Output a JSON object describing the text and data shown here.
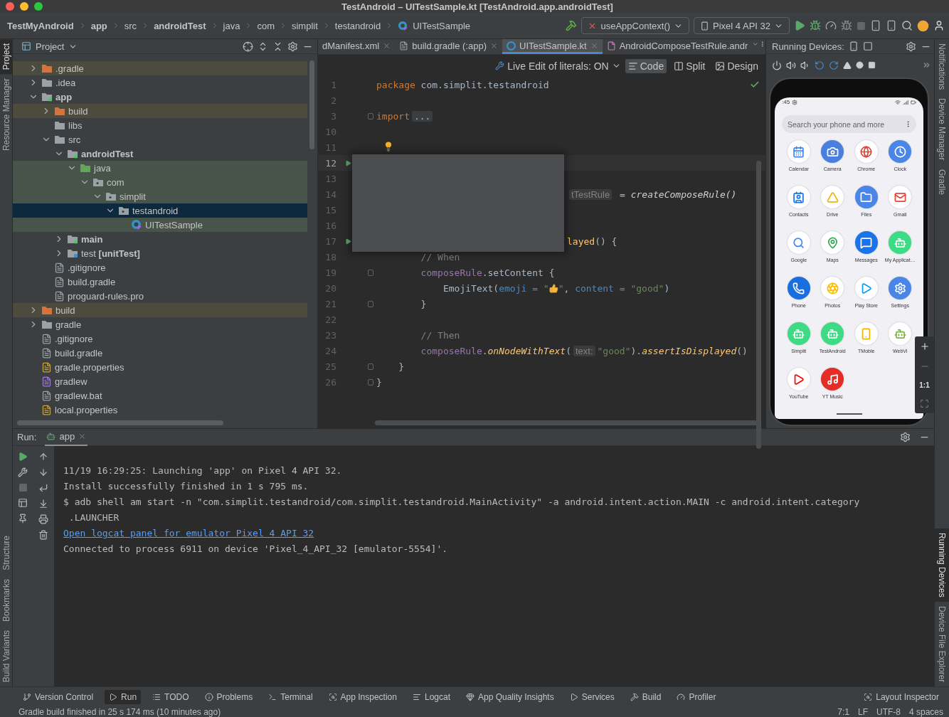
{
  "window": {
    "title": "TestAndroid – UITestSample.kt [TestAndroid.app.androidTest]"
  },
  "breadcrumb": [
    {
      "label": "TestMyAndroid",
      "bold": true
    },
    {
      "label": "app",
      "bold": true
    },
    {
      "label": "src",
      "bold": false
    },
    {
      "label": "androidTest",
      "bold": true
    },
    {
      "label": "java",
      "bold": false
    },
    {
      "label": "com",
      "bold": false
    },
    {
      "label": "simplit",
      "bold": false
    },
    {
      "label": "testandroid",
      "bold": false
    }
  ],
  "current_file": "UITestSample",
  "toolbar": {
    "run_config": "useAppContext()",
    "device": "Pixel 4 API 32"
  },
  "left_tool_tabs": [
    {
      "label": "Project",
      "selected": true
    },
    {
      "label": "Resource Manager",
      "selected": false
    },
    {
      "label": "Structure",
      "selected": false
    },
    {
      "label": "Bookmarks",
      "selected": false
    },
    {
      "label": "Build Variants",
      "selected": false
    }
  ],
  "right_tool_tabs": [
    {
      "label": "Notifications",
      "selected": false
    },
    {
      "label": "Device Manager",
      "selected": false
    },
    {
      "label": "Gradle",
      "selected": false
    },
    {
      "label": "Running Devices",
      "selected": true
    },
    {
      "label": "Device File Explorer",
      "selected": false
    }
  ],
  "project_panel": {
    "title": "Project",
    "tree": [
      {
        "label": ".gradle",
        "kind": "excluded-folder",
        "excluded": true,
        "test_source": false,
        "bold": false,
        "selected": false,
        "expanded": false
      },
      {
        "label": ".idea",
        "kind": "folder",
        "excluded": false,
        "test_source": false,
        "bold": false,
        "selected": false,
        "expanded": false
      },
      {
        "label": "app",
        "kind": "module",
        "excluded": false,
        "test_source": false,
        "bold": true,
        "selected": false,
        "expanded": true,
        "children": [
          {
            "label": "build",
            "kind": "excluded-folder",
            "excluded": true,
            "test_source": false,
            "bold": false,
            "selected": false,
            "expanded": false
          },
          {
            "label": "libs",
            "kind": "folder",
            "excluded": false,
            "test_source": false,
            "bold": false,
            "selected": false
          },
          {
            "label": "src",
            "kind": "folder",
            "excluded": false,
            "test_source": false,
            "bold": false,
            "selected": false,
            "expanded": true,
            "children": [
              {
                "label": "androidTest",
                "kind": "module",
                "excluded": false,
                "test_source": false,
                "bold": true,
                "selected": false,
                "expanded": true,
                "children": [
                  {
                    "label": "java",
                    "kind": "test-folder",
                    "excluded": false,
                    "test_source": true,
                    "bold": false,
                    "selected": false,
                    "expanded": true,
                    "children": [
                      {
                        "label": "com",
                        "kind": "package",
                        "excluded": false,
                        "test_source": true,
                        "bold": false,
                        "selected": false,
                        "expanded": true,
                        "children": [
                          {
                            "label": "simplit",
                            "kind": "package",
                            "excluded": false,
                            "test_source": true,
                            "bold": false,
                            "selected": false,
                            "expanded": true,
                            "children": [
                              {
                                "label": "testandroid",
                                "kind": "package",
                                "excluded": false,
                                "test_source": true,
                                "bold": false,
                                "selected": true,
                                "expanded": true,
                                "children": [
                                  {
                                    "label": "UITestSample",
                                    "kind": "test-class",
                                    "excluded": false,
                                    "test_source": true,
                                    "bold": false,
                                    "selected": false
                                  }
                                ]
                              }
                            ]
                          }
                        ]
                      }
                    ]
                  }
                ]
              },
              {
                "label": "main",
                "kind": "module",
                "excluded": false,
                "test_source": false,
                "bold": true,
                "selected": false,
                "expanded": false
              },
              {
                "label": "test **[unitTest]**",
                "kind": "unit-test-folder",
                "excluded": false,
                "test_source": false,
                "bold": false,
                "selected": false,
                "expanded": false
              }
            ]
          },
          {
            "label": ".gitignore",
            "kind": "ignore-file",
            "excluded": false,
            "test_source": false,
            "bold": false,
            "selected": false
          },
          {
            "label": "build.gradle",
            "kind": "gradle-file",
            "excluded": false,
            "test_source": false,
            "bold": false,
            "selected": false
          },
          {
            "label": "proguard-rules.pro",
            "kind": "text-file",
            "excluded": false,
            "test_source": false,
            "bold": false,
            "selected": false
          }
        ]
      },
      {
        "label": "build",
        "kind": "excluded-folder",
        "excluded": true,
        "test_source": false,
        "bold": false,
        "selected": false,
        "expanded": false
      },
      {
        "label": "gradle",
        "kind": "folder",
        "excluded": false,
        "test_source": false,
        "bold": false,
        "selected": false,
        "expanded": false
      },
      {
        "label": ".gitignore",
        "kind": "ignore-file",
        "excluded": false,
        "test_source": false,
        "bold": false,
        "selected": false
      },
      {
        "label": "build.gradle",
        "kind": "gradle-file",
        "excluded": false,
        "test_source": false,
        "bold": false,
        "selected": false
      },
      {
        "label": "gradle.properties",
        "kind": "properties-file",
        "excluded": false,
        "test_source": false,
        "bold": false,
        "selected": false
      },
      {
        "label": "gradlew",
        "kind": "script-file",
        "excluded": false,
        "test_source": false,
        "bold": false,
        "selected": false
      },
      {
        "label": "gradlew.bat",
        "kind": "text-file",
        "excluded": false,
        "test_source": false,
        "bold": false,
        "selected": false
      },
      {
        "label": "local.properties",
        "kind": "properties-file",
        "excluded": false,
        "test_source": false,
        "bold": false,
        "selected": false
      }
    ]
  },
  "editor": {
    "tabs": [
      {
        "label": "dManifest.xml",
        "kind": "xml",
        "selected": false
      },
      {
        "label": "build.gradle (:app)",
        "kind": "gradle",
        "selected": false
      },
      {
        "label": "UITestSample.kt",
        "kind": "kotlin",
        "selected": true
      },
      {
        "label": "AndroidComposeTestRule.andr",
        "kind": "class",
        "selected": false
      }
    ],
    "live_edit": "Live Edit of literals: ON",
    "view_modes": [
      {
        "label": "Code",
        "kind": "code",
        "selected": true
      },
      {
        "label": "Split",
        "kind": "split",
        "selected": false
      },
      {
        "label": "Design",
        "kind": "design",
        "selected": false
      }
    ],
    "lines": [
      {
        "number": "1",
        "current": false,
        "run_marker": false,
        "bulb": false,
        "fold": false,
        "after_popup": false,
        "segments": [
          {
            "text": "package",
            "kind": "keyword"
          },
          {
            "text": " com.simplit.testandroid",
            "kind": "plain"
          }
        ]
      },
      {
        "number": "2",
        "current": false,
        "run_marker": false,
        "bulb": false,
        "fold": false
      },
      {
        "number": "3",
        "current": false,
        "run_marker": false,
        "bulb": false,
        "fold": true,
        "after_popup": false,
        "segments": [
          {
            "text": "import",
            "kind": "keyword"
          },
          {
            "text": "...",
            "kind": "folded"
          }
        ]
      },
      {
        "number": "10",
        "current": false,
        "run_marker": false,
        "bulb": false,
        "fold": false
      },
      {
        "number": "11",
        "current": false,
        "run_marker": false,
        "bulb": true,
        "fold": false
      },
      {
        "number": "12",
        "current": true,
        "run_marker": true
      },
      {
        "number": "13",
        "current": false,
        "run_marker": false
      },
      {
        "number": "14",
        "current": false,
        "run_marker": false,
        "after_popup": true,
        "segments": [
          {
            "text": "tTestRule",
            "kind": "hint"
          },
          {
            "text": " = ",
            "kind": "plain"
          },
          {
            "text": "createComposeRule()",
            "kind": "call"
          }
        ]
      },
      {
        "number": "15",
        "current": false,
        "run_marker": false
      },
      {
        "number": "16",
        "current": false,
        "run_marker": false
      },
      {
        "number": "17",
        "current": false,
        "run_marker": true,
        "after_popup": true,
        "segments": [
          {
            "text": "layed",
            "kind": "function"
          },
          {
            "text": "() {",
            "kind": "plain"
          }
        ]
      },
      {
        "number": "18",
        "current": false,
        "run_marker": false,
        "bulb": false,
        "fold": false,
        "after_popup": false,
        "segments": [
          {
            "text": "        // When",
            "kind": "comment"
          }
        ]
      },
      {
        "number": "19",
        "current": false,
        "run_marker": false,
        "bulb": false,
        "fold": true,
        "after_popup": false,
        "segments": [
          {
            "text": "        composeRule",
            "kind": "property"
          },
          {
            "text": ".setContent {",
            "kind": "plain"
          }
        ]
      },
      {
        "number": "20",
        "current": false,
        "run_marker": false,
        "bulb": false,
        "fold": false,
        "after_popup": false,
        "segments": [
          {
            "text": "            EmojiText(",
            "kind": "plain"
          },
          {
            "text": "emoji",
            "kind": "param"
          },
          {
            "text": " = ",
            "kind": "param"
          },
          {
            "text": "\"",
            "kind": "string"
          },
          {
            "kind": "emoji"
          },
          {
            "text": "\"",
            "kind": "string"
          },
          {
            "text": ", ",
            "kind": "plain"
          },
          {
            "text": "content",
            "kind": "param"
          },
          {
            "text": " = ",
            "kind": "param"
          },
          {
            "text": "\"good\"",
            "kind": "string"
          },
          {
            "text": ")",
            "kind": "plain"
          }
        ]
      },
      {
        "number": "21",
        "current": false,
        "run_marker": false,
        "bulb": false,
        "fold": true,
        "after_popup": false,
        "segments": [
          {
            "text": "        }",
            "kind": "plain"
          }
        ]
      },
      {
        "number": "22",
        "current": false,
        "run_marker": false,
        "bulb": false,
        "fold": false
      },
      {
        "number": "23",
        "current": false,
        "run_marker": false,
        "bulb": false,
        "fold": false,
        "after_popup": false,
        "segments": [
          {
            "text": "        // Then",
            "kind": "comment"
          }
        ]
      },
      {
        "number": "24",
        "current": false,
        "run_marker": false,
        "bulb": false,
        "fold": false,
        "after_popup": false,
        "segments": [
          {
            "text": "        composeRule",
            "kind": "property"
          },
          {
            "text": ".",
            "kind": "plain"
          },
          {
            "text": "onNodeWithText",
            "kind": "ext"
          },
          {
            "text": "(",
            "kind": "plain"
          },
          {
            "text": "text:",
            "kind": "hint"
          },
          {
            "text": "\"good\"",
            "kind": "string"
          },
          {
            "text": ").",
            "kind": "plain"
          },
          {
            "text": "assertIsDisplayed",
            "kind": "ext"
          },
          {
            "text": "()",
            "kind": "plain"
          }
        ]
      },
      {
        "number": "25",
        "current": false,
        "run_marker": false,
        "bulb": false,
        "fold": true,
        "after_popup": false,
        "segments": [
          {
            "text": "    }",
            "kind": "plain"
          }
        ]
      },
      {
        "number": "26",
        "current": false,
        "run_marker": false,
        "bulb": false,
        "fold": true,
        "after_popup": false,
        "segments": [
          {
            "text": "}",
            "kind": "plain"
          }
        ]
      }
    ]
  },
  "running_devices": {
    "title": "Running Devices:",
    "phone": {
      "status_time": ":45",
      "search_placeholder": "Search your phone and more",
      "zoom_label": "1:1",
      "apps": [
        {
          "label": "Calendar",
          "color": "#4285f4"
        },
        {
          "label": "Camera",
          "color": "#4a7fe0"
        },
        {
          "label": "Chrome",
          "color": "#db4437"
        },
        {
          "label": "Clock",
          "color": "#4a86e8"
        },
        {
          "label": "Contacts",
          "color": "#1a73e8"
        },
        {
          "label": "Drive",
          "color": "#f4b400"
        },
        {
          "label": "Files",
          "color": "#4a86e8"
        },
        {
          "label": "Gmail",
          "color": "#ea4335"
        },
        {
          "label": "Google",
          "color": "#4285f4"
        },
        {
          "label": "Maps",
          "color": "#34a853"
        },
        {
          "label": "Messages",
          "color": "#1a73e8"
        },
        {
          "label": "My Applicat…",
          "color": "#3ddc84"
        },
        {
          "label": "Phone",
          "color": "#1a6fe0"
        },
        {
          "label": "Photos",
          "color": "#fbbc04"
        },
        {
          "label": "Play Store",
          "color": "#00a0f0"
        },
        {
          "label": "Settings",
          "color": "#4a86e8"
        },
        {
          "label": "Simplit",
          "color": "#3ddc84"
        },
        {
          "label": "TestAndroid",
          "color": "#3ddc84"
        },
        {
          "label": "TMoble",
          "color": "#f0b400"
        },
        {
          "label": "WebVi",
          "color": "#7cb342"
        },
        {
          "label": "YouTube",
          "color": "#ff0000"
        },
        {
          "label": "YT Music",
          "color": "#e52d27"
        }
      ]
    }
  },
  "run_panel": {
    "title": "Run:",
    "tabs": [
      {
        "label": "app",
        "selected": true
      }
    ],
    "console": [
      {
        "text": "11/19 16:29:25: Launching 'app' on Pixel 4 API 32.",
        "kind": "plain"
      },
      {
        "text": "Install successfully finished in 1 s 795 ms.",
        "kind": "plain"
      },
      {
        "text": "$ adb shell am start -n \"com.simplit.testandroid/com.simplit.testandroid.MainActivity\" -a android.intent.action.MAIN -c android.intent.category",
        "kind": "plain"
      },
      {
        "text": " .LAUNCHER",
        "kind": "plain"
      },
      {
        "text": "Open logcat panel for emulator Pixel 4 API 32",
        "kind": "link"
      },
      {
        "text": "Connected to process 6911 on device 'Pixel_4_API_32 [emulator-5554]'.",
        "kind": "plain"
      }
    ]
  },
  "tool_window_bar": [
    {
      "label": "Version Control",
      "selected": false
    },
    {
      "label": "Run",
      "selected": true
    },
    {
      "label": "TODO",
      "selected": false
    },
    {
      "label": "Problems",
      "selected": false
    },
    {
      "label": "Terminal",
      "selected": false
    },
    {
      "label": "App Inspection",
      "selected": false
    },
    {
      "label": "Logcat",
      "selected": false
    },
    {
      "label": "App Quality Insights",
      "selected": false
    },
    {
      "label": "Services",
      "selected": false
    },
    {
      "label": "Build",
      "selected": false
    },
    {
      "label": "Profiler",
      "selected": false
    }
  ],
  "tool_window_bar_right": [
    {
      "label": "Layout Inspector",
      "selected": false
    }
  ],
  "status_bar": {
    "message": "Gradle build finished in 25 s 174 ms (10 minutes ago)",
    "items": [
      "7:1",
      "LF",
      "UTF-8",
      "4 spaces"
    ]
  }
}
